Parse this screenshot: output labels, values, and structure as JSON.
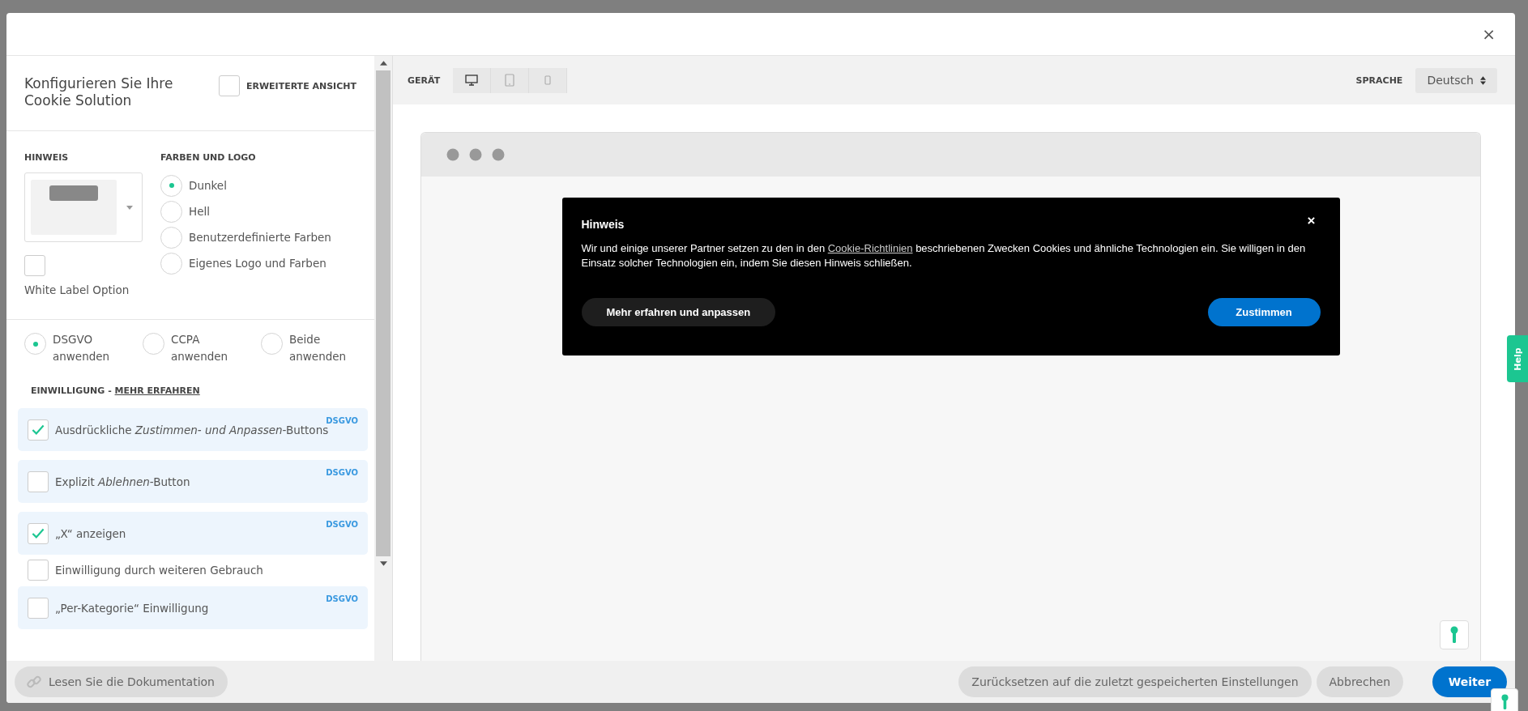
{
  "window": {
    "close": "×"
  },
  "sidebar": {
    "title": "Konfigurieren Sie Ihre Cookie Solution",
    "advanced_view": {
      "label": "ERWEITERTE ANSICHT",
      "checked": false
    },
    "notice": {
      "heading": "HINWEIS"
    },
    "white_label": {
      "label": "White Label Option",
      "checked": false
    },
    "colors": {
      "heading": "FARBEN UND LOGO",
      "options": [
        {
          "label": "Dunkel",
          "selected": true
        },
        {
          "label": "Hell",
          "selected": false
        },
        {
          "label": "Benutzerdefinierte Farben",
          "selected": false
        },
        {
          "label": "Eigenes Logo und Farben",
          "selected": false
        }
      ]
    },
    "regulations": [
      {
        "label": "DSGVO anwenden",
        "selected": true
      },
      {
        "label": "CCPA anwenden",
        "selected": false
      },
      {
        "label": "Beide anwenden",
        "selected": false
      }
    ],
    "consent": {
      "heading": "EINWILLIGUNG - ",
      "link": "MEHR ERFAHREN"
    },
    "consent_options": [
      {
        "label": "Ausdrückliche *Zustimmen- und Anpassen*-Buttons",
        "checked": true,
        "tag": "DSGVO"
      },
      {
        "label": "Explizit *Ablehnen*-Button",
        "checked": false,
        "tag": "DSGVO"
      },
      {
        "label": "„X“ anzeigen",
        "checked": true,
        "tag": "DSGVO"
      },
      {
        "label": "Einwilligung durch weiteren Gebrauch",
        "checked": false
      },
      {
        "label": "„Per-Kategorie“ Einwilligung",
        "checked": false,
        "tag": "DSGVO"
      }
    ]
  },
  "preview_toolbar": {
    "device_label": "GERÄT",
    "devices": [
      {
        "kind": "desktop",
        "selected": true
      },
      {
        "kind": "tablet",
        "selected": false
      },
      {
        "kind": "phone",
        "selected": false
      }
    ],
    "language_label": "SPRACHE",
    "language": "Deutsch"
  },
  "banner": {
    "title": "Hinweis",
    "close": "×",
    "text_before": "Wir und einige unserer Partner setzen zu den in den ",
    "link": "Cookie-Richtlinien",
    "text_after": " beschriebenen Zwecken Cookies und ähnliche Technologien ein. Sie willigen in den Einsatz solcher Technologien ein, indem Sie diesen Hinweis schließen.",
    "more_button": "Mehr erfahren und anpassen",
    "accept_button": "Zustimmen"
  },
  "footer": {
    "docs_button": "Lesen Sie die Dokumentation",
    "reset_button": "Zurücksetzen auf die zuletzt gespeicherten Einstellungen",
    "cancel_button": "Abbrechen",
    "next_button": "Weiter"
  },
  "help_tab": "Help"
}
